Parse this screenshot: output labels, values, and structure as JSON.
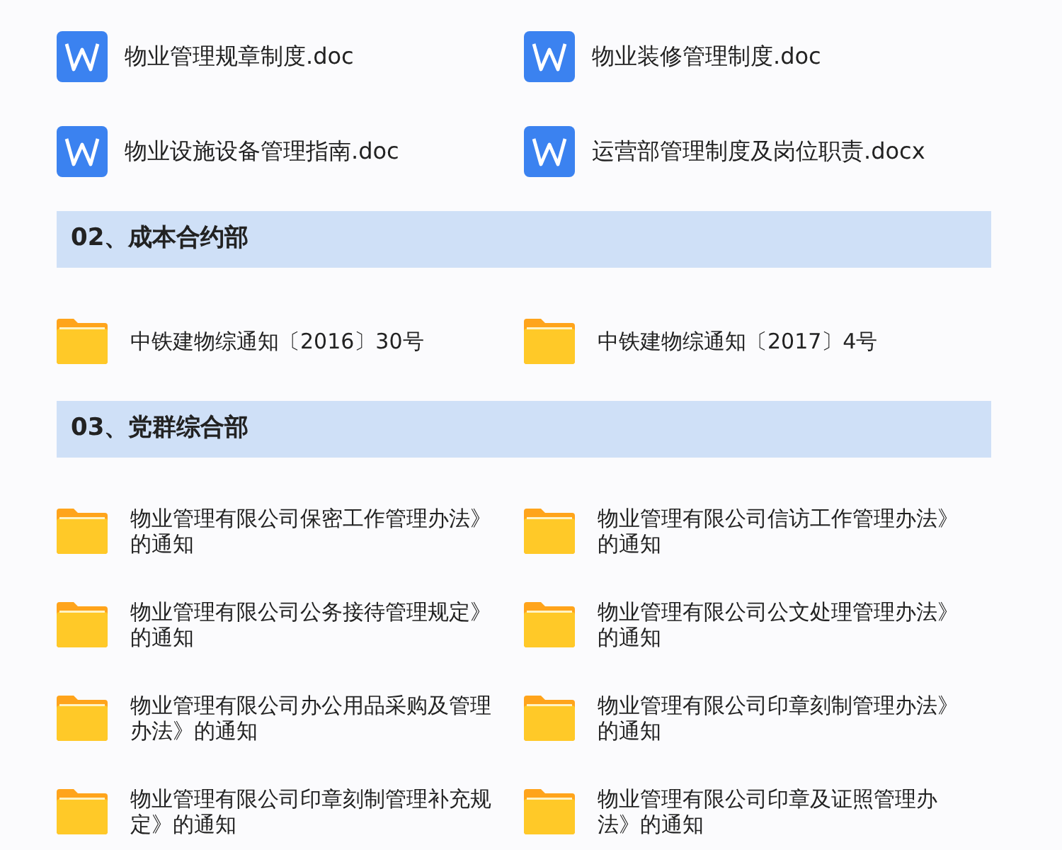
{
  "files": [
    {
      "kind": "doc",
      "name": "物业管理规章制度.doc"
    },
    {
      "kind": "doc",
      "name": "物业装修管理制度.doc"
    },
    {
      "kind": "doc",
      "name": "物业设施设备管理指南.doc"
    },
    {
      "kind": "doc",
      "name": "运营部管理制度及岗位职责.docx"
    }
  ],
  "sections": [
    {
      "title": "02、成本合约部",
      "items": [
        {
          "kind": "folder",
          "name": "中铁建物综通知〔2016〕30号"
        },
        {
          "kind": "folder",
          "name": "中铁建物综通知〔2017〕4号"
        }
      ]
    },
    {
      "title": "03、党群综合部",
      "items": [
        {
          "kind": "folder",
          "name": "物业管理有限公司保密工作管理办法》的通知"
        },
        {
          "kind": "folder",
          "name": "物业管理有限公司信访工作管理办法》的通知"
        },
        {
          "kind": "folder",
          "name": "物业管理有限公司公务接待管理规定》的通知"
        },
        {
          "kind": "folder",
          "name": "物业管理有限公司公文处理管理办法》的通知"
        },
        {
          "kind": "folder",
          "name": "物业管理有限公司办公用品采购及管理办法》的通知"
        },
        {
          "kind": "folder",
          "name": "物业管理有限公司印章刻制管理办法》的通知"
        },
        {
          "kind": "folder",
          "name": "物业管理有限公司印章刻制管理补充规定》的通知"
        },
        {
          "kind": "folder",
          "name": "物业管理有限公司印章及证照管理办法》的通知"
        }
      ]
    }
  ]
}
